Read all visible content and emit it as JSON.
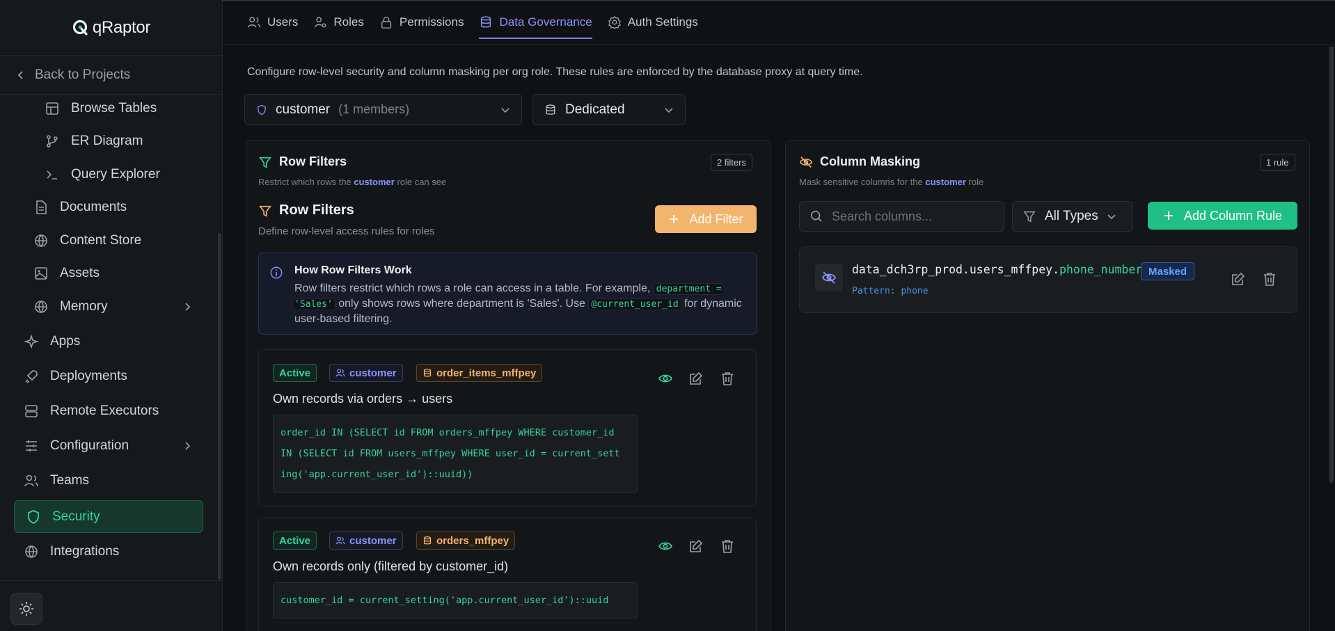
{
  "app": {
    "name": "qRaptor"
  },
  "sidebar": {
    "back_label": "Back to Projects",
    "items": [
      {
        "label": "Browse Tables",
        "icon": "table-icon"
      },
      {
        "label": "ER Diagram",
        "icon": "diagram-icon"
      },
      {
        "label": "Query Explorer",
        "icon": "terminal-icon"
      },
      {
        "label": "Documents",
        "icon": "document-icon"
      },
      {
        "label": "Content Store",
        "icon": "globe-icon"
      },
      {
        "label": "Assets",
        "icon": "image-icon"
      },
      {
        "label": "Memory",
        "icon": "globe-icon"
      },
      {
        "label": "Apps",
        "icon": "sparkles-icon"
      },
      {
        "label": "Deployments",
        "icon": "rocket-icon"
      },
      {
        "label": "Remote Executors",
        "icon": "server-icon"
      },
      {
        "label": "Configuration",
        "icon": "sliders-icon"
      },
      {
        "label": "Teams",
        "icon": "users-icon"
      },
      {
        "label": "Security",
        "icon": "shield-icon"
      },
      {
        "label": "Integrations",
        "icon": "globe-icon"
      }
    ]
  },
  "tabs": [
    {
      "label": "Users"
    },
    {
      "label": "Roles"
    },
    {
      "label": "Permissions"
    },
    {
      "label": "Data Governance"
    },
    {
      "label": "Auth Settings"
    }
  ],
  "intro": "Configure row-level security and column masking per org role. These rules are enforced by the database proxy at query time.",
  "role_select": {
    "value": "customer",
    "members": "(1 members)"
  },
  "mode_select": {
    "value": "Dedicated"
  },
  "row_filters": {
    "title": "Row Filters",
    "count": "2 filters",
    "sub_prefix": "Restrict which rows the",
    "sub_role": "customer",
    "sub_suffix": "role can see",
    "inner_title": "Row Filters",
    "inner_sub": "Define row-level access rules for roles",
    "add_label": "Add Filter",
    "info": {
      "title": "How Row Filters Work",
      "t1": "Row filters restrict which rows a role can access in a table. For example,",
      "code1": "department = 'Sales'",
      "t2": "only shows rows where department is 'Sales'. Use",
      "code2": "@current_user_id",
      "t3": "for dynamic user-based filtering."
    },
    "filters": [
      {
        "status": "Active",
        "role": "customer",
        "table": "order_items_mffpey",
        "name": "Own records via orders → users",
        "sql_lines": [
          "order_id IN (SELECT id FROM orders_mffpey WHERE customer_id",
          "IN (SELECT id FROM users_mffpey WHERE user_id = current_sett",
          "ing('app.current_user_id')::uuid))"
        ]
      },
      {
        "status": "Active",
        "role": "customer",
        "table": "orders_mffpey",
        "name": "Own records only (filtered by customer_id)",
        "sql_lines": [
          "customer_id = current_setting('app.current_user_id')::uuid"
        ]
      }
    ]
  },
  "column_masking": {
    "title": "Column Masking",
    "count": "1 rule",
    "sub_prefix": "Mask sensitive columns for the",
    "sub_role": "customer",
    "sub_suffix": "role",
    "search_placeholder": "Search columns...",
    "types_label": "All Types",
    "add_label": "Add Column Rule",
    "rules": [
      {
        "table_path": "data_dch3rp_prod.users_mffpey.",
        "column": "phone_number",
        "badge": "Masked",
        "pattern": "Pattern: phone"
      }
    ]
  },
  "colors": {
    "accent": "#8b93ff",
    "green": "#1fbf85",
    "orange": "#f3b46d"
  }
}
